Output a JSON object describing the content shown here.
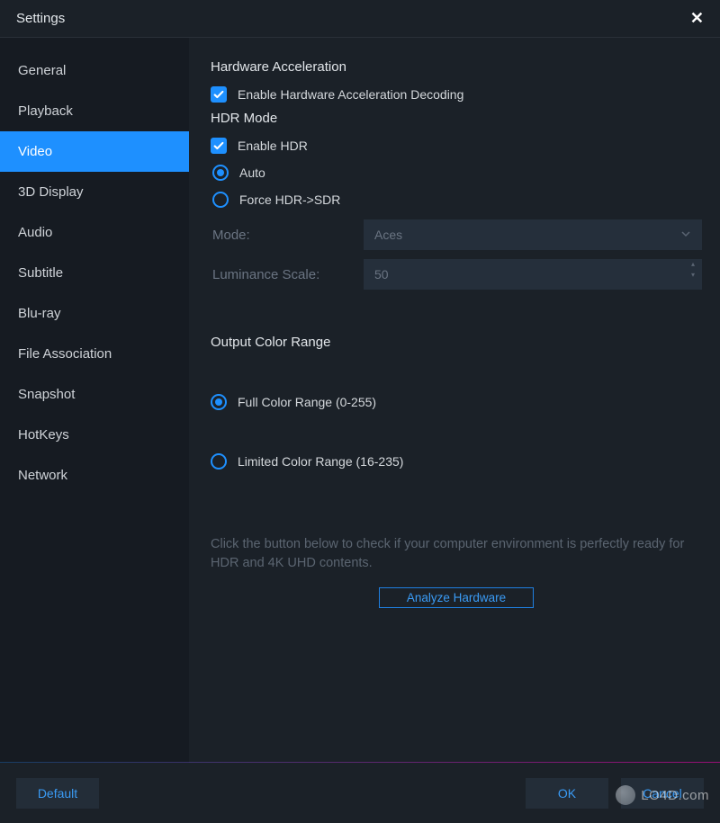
{
  "window": {
    "title": "Settings"
  },
  "sidebar": {
    "items": [
      {
        "label": "General"
      },
      {
        "label": "Playback"
      },
      {
        "label": "Video",
        "active": true
      },
      {
        "label": "3D Display"
      },
      {
        "label": "Audio"
      },
      {
        "label": "Subtitle"
      },
      {
        "label": "Blu-ray"
      },
      {
        "label": "File Association"
      },
      {
        "label": "Snapshot"
      },
      {
        "label": "HotKeys"
      },
      {
        "label": "Network"
      }
    ]
  },
  "video": {
    "hw_accel_title": "Hardware Acceleration",
    "hw_accel_checkbox": "Enable Hardware Acceleration Decoding",
    "hdr_title": "HDR Mode",
    "hdr_enable": "Enable HDR",
    "hdr_auto": "Auto",
    "hdr_force": "Force HDR->SDR",
    "mode_label": "Mode:",
    "mode_value": "Aces",
    "lum_label": "Luminance Scale:",
    "lum_value": "50",
    "output_range_title": "Output Color Range",
    "range_full": "Full Color Range (0-255)",
    "range_limited": "Limited Color Range (16-235)",
    "help_text": "Click the button below to check if your computer environment is perfectly ready for HDR and 4K UHD contents.",
    "analyze_btn": "Analyze Hardware"
  },
  "footer": {
    "default": "Default",
    "ok": "OK",
    "cancel": "Cancel"
  },
  "watermark": "LO4D.com"
}
